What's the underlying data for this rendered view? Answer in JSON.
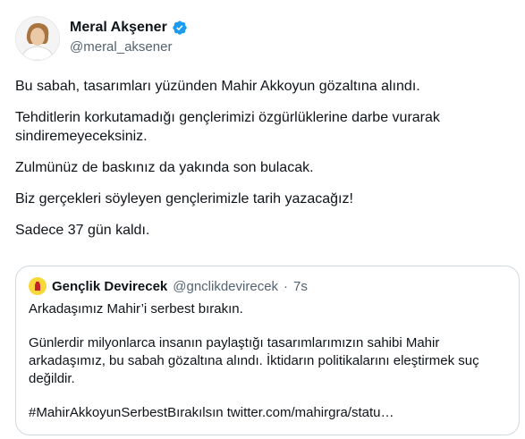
{
  "author": {
    "name": "Meral Akşener",
    "handle": "@meral_aksener",
    "verified_color": "#1d9bf0",
    "avatar_icon": "person-avatar"
  },
  "tweet": {
    "paragraphs": [
      "Bu sabah, tasarımları yüzünden Mahir Akkoyun gözaltına alındı.",
      "Tehditlerin korkutamadığı gençlerimizi özgürlüklerine darbe vurarak sindiremeyeceksiniz.",
      "Zulmünüz de baskınız da yakında son bulacak.",
      "Biz gerçekleri söyleyen gençlerimizle tarih yazacağız!",
      "Sadece 37 gün kaldı."
    ]
  },
  "quoted": {
    "name": "Gençlik Devirecek",
    "handle": "@gnclikdevirecek",
    "separator": "·",
    "time": "7s",
    "avatar_color": "#f7d73a",
    "paragraphs": [
      "Arkadaşımız Mahir’i serbest bırakın.",
      "Günlerdir milyonlarca insanın paylaştığı tasarımlarımızın sahibi Mahir arkadaşımız, bu sabah gözaltına alındı. İktidarın politikalarını eleştirmek suç değildir.",
      "#MahirAkkoyunSerbestBırakılsın twitter.com/mahirgra/statu…"
    ]
  }
}
